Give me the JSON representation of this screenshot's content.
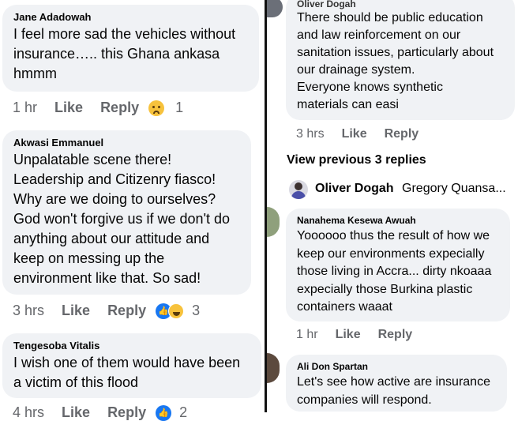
{
  "left": {
    "comments": [
      {
        "name": "Jane Adadowah",
        "lines": [
          "I feel more sad the vehicles without",
          "insurance….. this Ghana ankasa",
          "hmmm"
        ],
        "time": "1 hr",
        "like": "Like",
        "reply": "Reply",
        "reaction_count": "1",
        "reaction_icons": [
          "sad-emoji-icon"
        ]
      },
      {
        "name": "Akwasi Emmanuel",
        "lines": [
          "Unpalatable scene there!",
          "Leadership and Citizenry fiasco!",
          "Why are we doing to ourselves?",
          "God won't forgive us if we don't do",
          "anything about our attitude and",
          "keep on messing up the",
          "environment like that. So sad!"
        ],
        "time": "3 hrs",
        "like": "Like",
        "reply": "Reply",
        "reaction_count": "3",
        "reaction_icons": [
          "like-reaction-icon",
          "haha-reaction-icon"
        ]
      },
      {
        "name": "Tengesoba Vitalis",
        "lines": [
          "I wish one of them would have been",
          "a victim of this flood"
        ],
        "time": "4 hrs",
        "like": "Like",
        "reply": "Reply",
        "reaction_count": "2"
      }
    ]
  },
  "right": {
    "comments": [
      {
        "name": "Oliver Dogah",
        "lines": [
          "There should be public education",
          "and law reinforcement on our",
          "sanitation issues, particularly about",
          "our drainage system.",
          "Everyone knows synthetic",
          "materials can easi"
        ],
        "time": "3 hrs",
        "like": "Like",
        "reply": "Reply"
      },
      {
        "name": "Nanahema Kesewa Awuah",
        "lines": [
          "Yoooooo thus the result of how we",
          "keep our environments expecially",
          "those living in Accra... dirty nkoaaa",
          "expecially those Burkina plastic",
          "containers waaat"
        ],
        "time": "1 hr",
        "like": "Like",
        "reply": "Reply"
      },
      {
        "name": "Ali Don Spartan",
        "lines": [
          "Let's see how active are insurance",
          "companies will respond."
        ]
      }
    ],
    "view_previous": "View previous 3 replies",
    "reply_preview": {
      "name": "Oliver Dogah",
      "text": "Gregory Quansa..."
    }
  }
}
